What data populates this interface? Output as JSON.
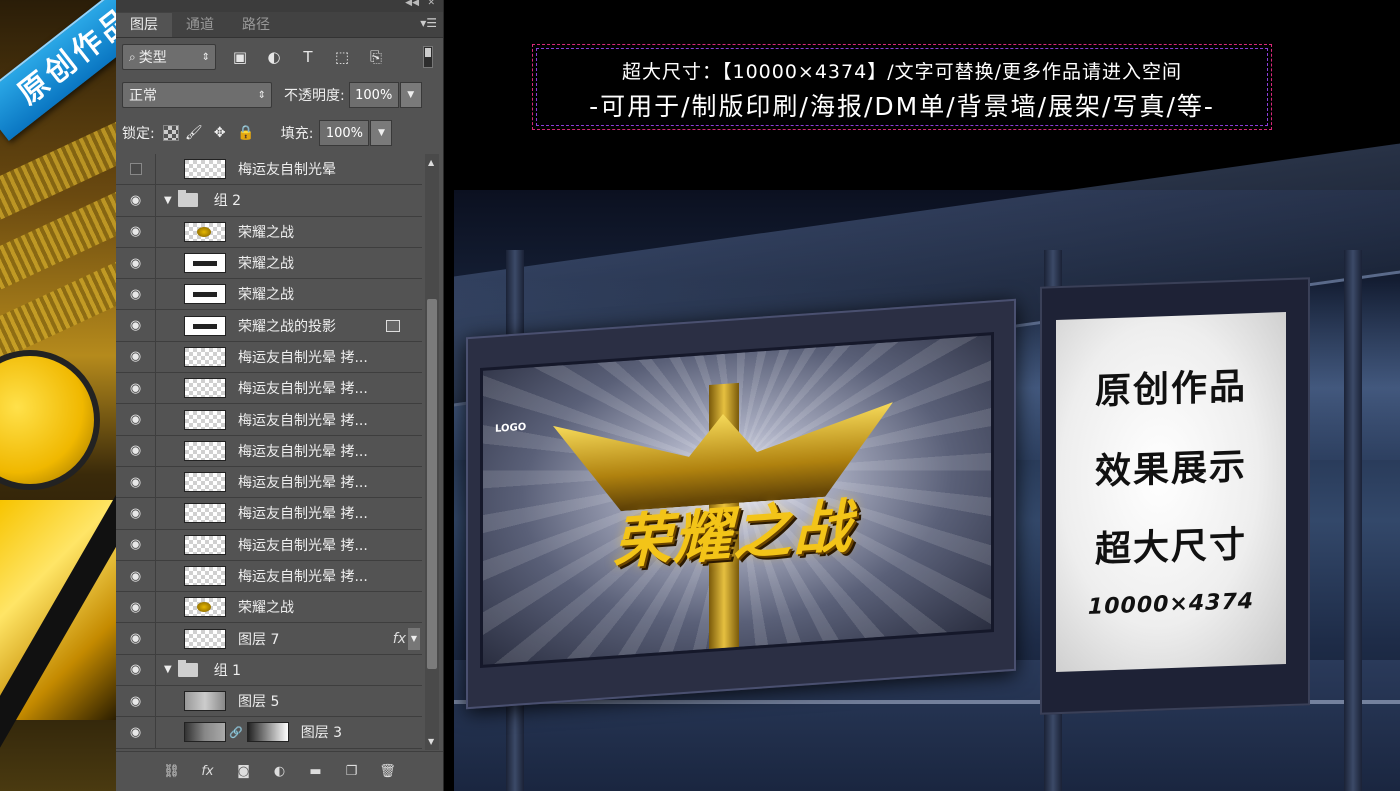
{
  "badge": {
    "text": "原创作品"
  },
  "layers_panel": {
    "tabs": [
      {
        "label": "图层",
        "active": true
      },
      {
        "label": "通道",
        "active": false
      },
      {
        "label": "路径",
        "active": false
      }
    ],
    "filter_kind": "类型",
    "blend_mode": "正常",
    "opacity_label": "不透明度:",
    "opacity_value": "100%",
    "lock_label": "锁定:",
    "fill_label": "填充:",
    "fill_value": "100%",
    "layers": [
      {
        "name": "梅运友自制光晕",
        "visible": false,
        "thumb": "checker",
        "indent": false
      },
      {
        "name": "组 2",
        "visible": true,
        "type": "group"
      },
      {
        "name": "荣耀之战",
        "visible": true,
        "thumb": "gold"
      },
      {
        "name": "荣耀之战",
        "visible": true,
        "thumb": "dark"
      },
      {
        "name": "荣耀之战",
        "visible": true,
        "thumb": "dark"
      },
      {
        "name": "荣耀之战的投影",
        "visible": true,
        "thumb": "dark",
        "smart": true
      },
      {
        "name": "梅运友自制光晕 拷...",
        "visible": true,
        "thumb": "checker"
      },
      {
        "name": "梅运友自制光晕 拷...",
        "visible": true,
        "thumb": "checker"
      },
      {
        "name": "梅运友自制光晕 拷...",
        "visible": true,
        "thumb": "checker"
      },
      {
        "name": "梅运友自制光晕 拷...",
        "visible": true,
        "thumb": "checker"
      },
      {
        "name": "梅运友自制光晕 拷...",
        "visible": true,
        "thumb": "checker"
      },
      {
        "name": "梅运友自制光晕 拷...",
        "visible": true,
        "thumb": "checker"
      },
      {
        "name": "梅运友自制光晕 拷...",
        "visible": true,
        "thumb": "checker"
      },
      {
        "name": "梅运友自制光晕 拷...",
        "visible": true,
        "thumb": "checker"
      },
      {
        "name": "荣耀之战",
        "visible": true,
        "thumb": "gold"
      },
      {
        "name": "图层 7",
        "visible": true,
        "thumb": "checker",
        "fx": "fx"
      },
      {
        "name": "组 1",
        "visible": true,
        "type": "group"
      },
      {
        "name": "图层 5",
        "visible": true,
        "thumb": "cloud"
      },
      {
        "name": "图层 3",
        "visible": true,
        "thumb": "grad",
        "mask": true
      }
    ]
  },
  "info_box": {
    "line1": "超大尺寸：【10000×4374】/文字可替换/更多作品请进入空间",
    "line2": "-可用于/制版印刷/海报/DM单/背景墙/展架/写真/等-"
  },
  "billboard": {
    "logo": "LOGO",
    "title": "荣耀之战"
  },
  "lightbox": {
    "line1": "原创作品",
    "line2": "效果展示",
    "line3": "超大尺寸",
    "line4": "10000×4374"
  },
  "colors": {
    "ps_panel": "#535353",
    "badge_blue": "#1a8fd6",
    "info_border": "#d8287a",
    "title_gold": "#f3c418"
  }
}
